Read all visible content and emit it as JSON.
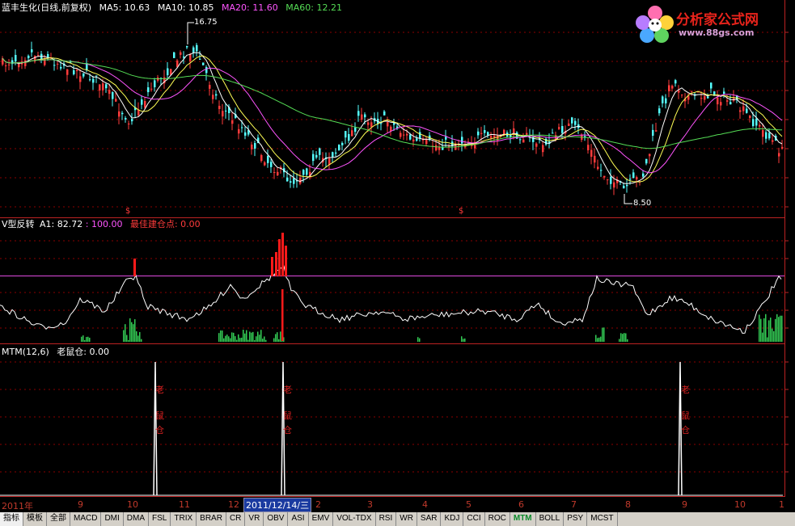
{
  "main_header": {
    "title": "蓝丰生化(日线,前复权)",
    "ma5": "MA5: 10.63",
    "ma10": "MA10: 10.85",
    "ma20": "MA20: 11.60",
    "ma60": "MA60: 12.21"
  },
  "main_annotations": {
    "high": "16.75",
    "low": "8.50",
    "signal_mark": "$"
  },
  "v_header": {
    "name": "V型反转",
    "a1": "A1: 82.72",
    "level": ": 100.00",
    "best": "最佳建仓点: 0.00"
  },
  "mtm_header": {
    "name": "MTM(12,6)",
    "rat": "老鼠仓: 0.00"
  },
  "rat_label": {
    "c1": "老",
    "c2": "鼠",
    "c3": "仓"
  },
  "xaxis": {
    "labels": [
      "2011年",
      "9",
      "10",
      "11",
      "12",
      "2011/12/14/三",
      "2",
      "3",
      "4",
      "5",
      "6",
      "7",
      "8",
      "9",
      "10",
      "1"
    ]
  },
  "tabs": [
    "指标",
    "模板",
    "全部",
    "MACD",
    "DMI",
    "DMA",
    "FSL",
    "TRIX",
    "BRAR",
    "CR",
    "VR",
    "OBV",
    "ASI",
    "EMV",
    "VOL-TDX",
    "RSI",
    "WR",
    "SAR",
    "KDJ",
    "CCI",
    "ROC",
    "MTM",
    "BOLL",
    "PSY",
    "MCST"
  ],
  "active_tab": "MTM",
  "logo": {
    "title": "分析家公式网",
    "url": "www.88gs.com"
  },
  "colors": {
    "up": "#ff3b3b",
    "down": "#55ffff",
    "ma5": "#ffffff",
    "ma10": "#ffff55",
    "ma20": "#ff55ff",
    "ma60": "#55dd55",
    "grid": "#8b0000"
  }
}
